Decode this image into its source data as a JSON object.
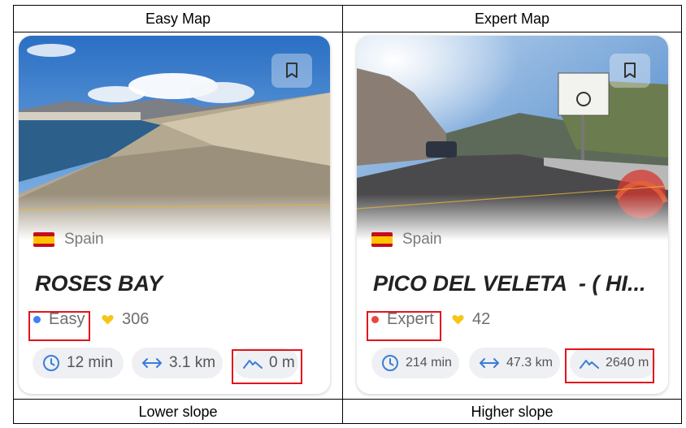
{
  "headers": {
    "left": "Easy Map",
    "right": "Expert Map"
  },
  "footers": {
    "left": "Lower slope",
    "right": "Higher slope"
  },
  "cards": [
    {
      "country": "Spain",
      "title": "ROSES BAY",
      "difficulty": "Easy",
      "difficulty_color": "#3b82f6",
      "likes": "306",
      "duration": "12 min",
      "distance": "3.1 km",
      "elevation": "0 m"
    },
    {
      "country": "Spain",
      "title": "PICO DEL VELETA  - ( HI...",
      "difficulty": "Expert",
      "difficulty_color": "#ef4444",
      "likes": "42",
      "duration": "214 min",
      "distance": "47.3 km",
      "elevation": "2640 m"
    }
  ],
  "icons": {
    "bookmark": "bookmark-icon",
    "flag": "spain-flag-icon",
    "heart": "heart-icon",
    "clock": "clock-icon",
    "distance": "arrows-horizontal-icon",
    "elevation": "mountain-icon"
  },
  "colors": {
    "heart": "#f5c518",
    "stat_icon": "#3b7dd8",
    "highlight_box": "#e3141b"
  }
}
